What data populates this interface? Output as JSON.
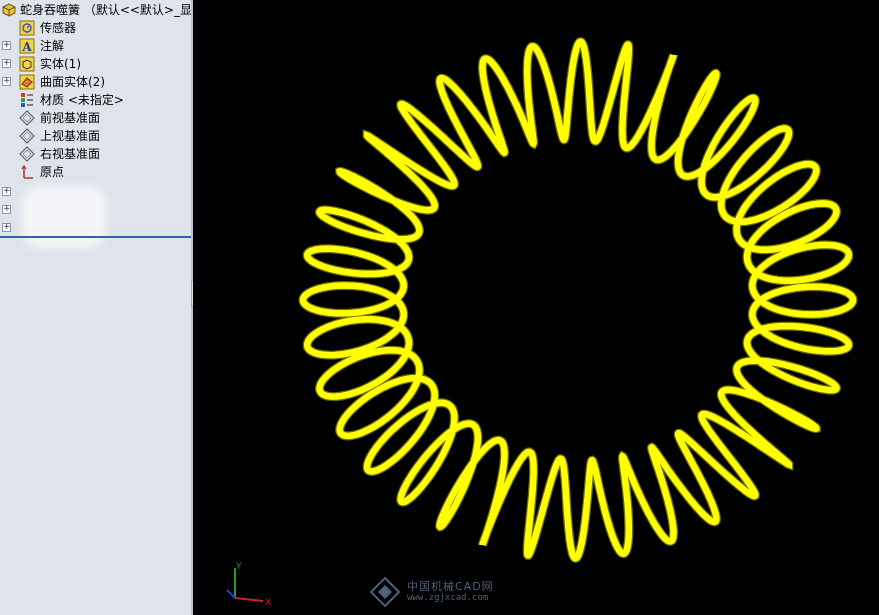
{
  "tree": {
    "root_label": "蛇身吞噬簧 （默认<<默认>_显示",
    "items": [
      {
        "label": "传感器",
        "icon": "sensor-icon",
        "expander": false
      },
      {
        "label": "注解",
        "icon": "annotation-icon",
        "expander": true
      },
      {
        "label": "实体(1)",
        "icon": "solid-body-icon",
        "expander": true
      },
      {
        "label": "曲面实体(2)",
        "icon": "surface-body-icon",
        "expander": true
      },
      {
        "label": "材质 <未指定>",
        "icon": "material-icon",
        "expander": false
      },
      {
        "label": "前视基准面",
        "icon": "plane-icon",
        "expander": false
      },
      {
        "label": "上视基准面",
        "icon": "plane-icon",
        "expander": false
      },
      {
        "label": "右视基准面",
        "icon": "plane-icon",
        "expander": false
      },
      {
        "label": "原点",
        "icon": "origin-icon",
        "expander": false
      }
    ]
  },
  "viewport": {
    "background": "#000000",
    "model_color": "#ffff00",
    "axis_labels": {
      "x": "X",
      "y": "Y"
    }
  },
  "watermark": {
    "name": "中国机械CAD网",
    "url": "www.zgjxcad.com"
  }
}
